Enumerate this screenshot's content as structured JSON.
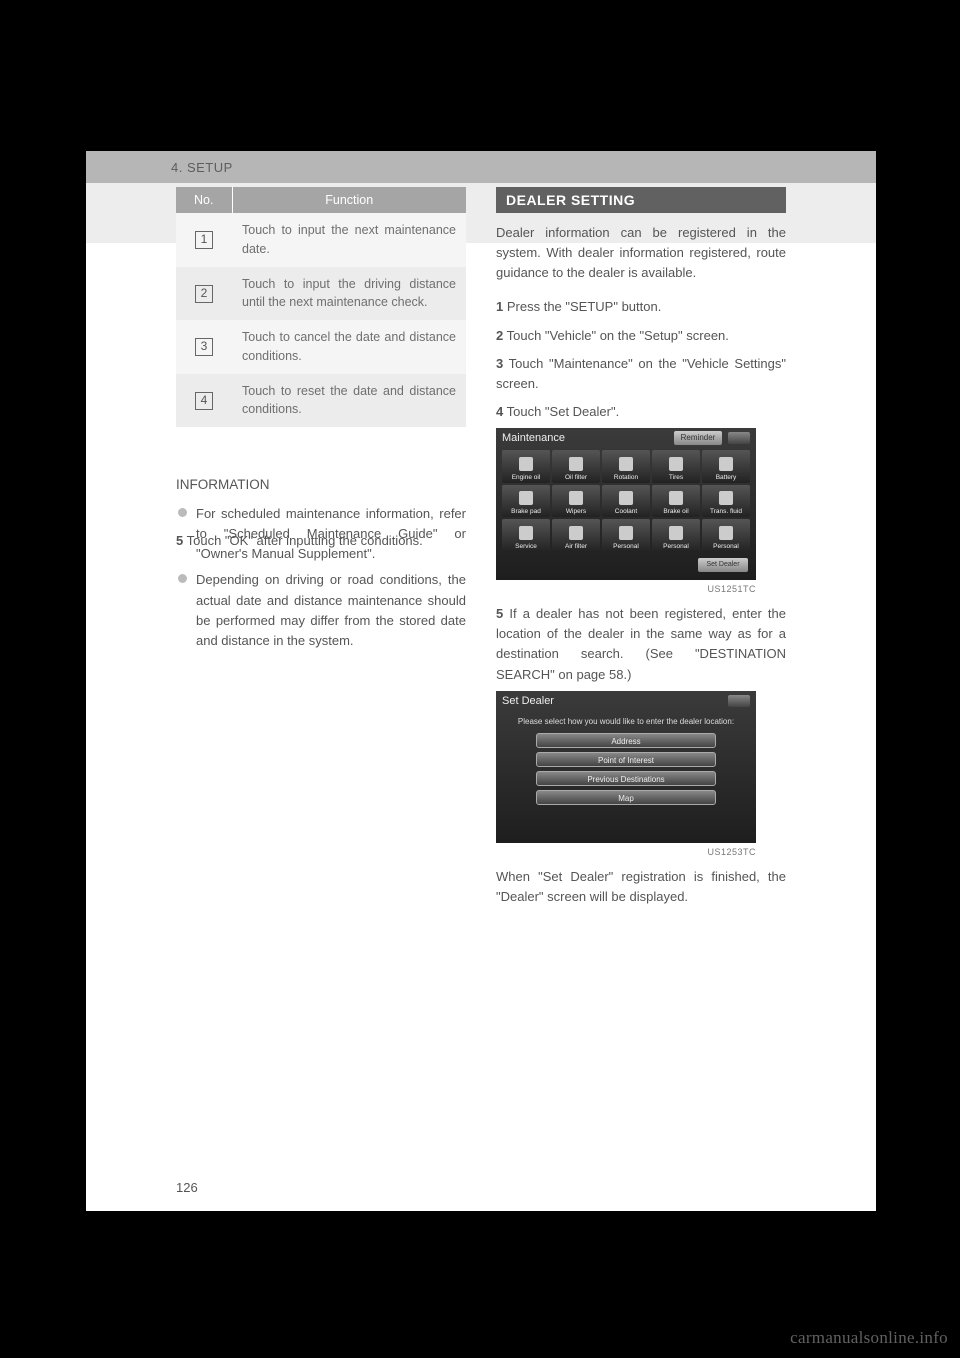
{
  "header": {
    "chapter": "4. SETUP"
  },
  "function_table": {
    "columns": [
      "No.",
      "Function"
    ],
    "rows": [
      {
        "num": "1",
        "text": "Touch to input the next maintenance date."
      },
      {
        "num": "2",
        "text": "Touch to input the driving distance until the next maintenance check."
      },
      {
        "num": "3",
        "text": "Touch to cancel the date and distance conditions."
      },
      {
        "num": "4",
        "text": "Touch to reset the date and distance conditions."
      }
    ]
  },
  "left_step": {
    "num": "5",
    "text": "Touch \"OK\" after inputting the conditions."
  },
  "info": {
    "title": "INFORMATION",
    "items": [
      "For scheduled maintenance information, refer to \"Scheduled Maintenance Guide\" or \"Owner's Manual Supplement\".",
      "Depending on driving or road conditions, the actual date and distance maintenance should be performed may differ from the stored date and distance in the system."
    ]
  },
  "right": {
    "heading": "DEALER SETTING",
    "intro": "Dealer information can be registered in the system. With dealer information registered, route guidance to the dealer is available.",
    "step1": {
      "num": "1",
      "text": "Press the \"SETUP\" button."
    },
    "step2": {
      "num": "2",
      "text": "Touch \"Vehicle\" on the \"Setup\" screen."
    },
    "step3": {
      "num": "3",
      "text": "Touch \"Maintenance\" on the \"Vehicle Settings\" screen."
    },
    "step4": {
      "num": "4",
      "text": "Touch \"Set Dealer\"."
    },
    "step5": {
      "num": "5",
      "text": "If a dealer has not been registered, enter the location of the dealer in the same way as for a destination search. (See \"DESTINATION SEARCH\" on page 58.)"
    },
    "after_set": "When \"Set Dealer\" registration is finished, the \"Dealer\" screen will be displayed."
  },
  "screen_maint": {
    "title": "Maintenance",
    "reminder": "Reminder",
    "cells": [
      "Engine oil",
      "Oil filter",
      "Rotation",
      "Tires",
      "Battery",
      "Brake pad",
      "Wipers",
      "Coolant",
      "Brake oil",
      "Trans. fluid",
      "Service",
      "Air filter",
      "Personal",
      "Personal",
      "Personal"
    ],
    "set_dealer_btn": "Set Dealer",
    "code": "US1251TC"
  },
  "screen_setdealer": {
    "title": "Set Dealer",
    "msg": "Please select how you would like to enter the dealer location:",
    "options": [
      "Address",
      "Point of Interest",
      "Previous Destinations",
      "Map"
    ],
    "code": "US1253TC"
  },
  "page_number": "126",
  "watermark": "carmanualsonline.info"
}
